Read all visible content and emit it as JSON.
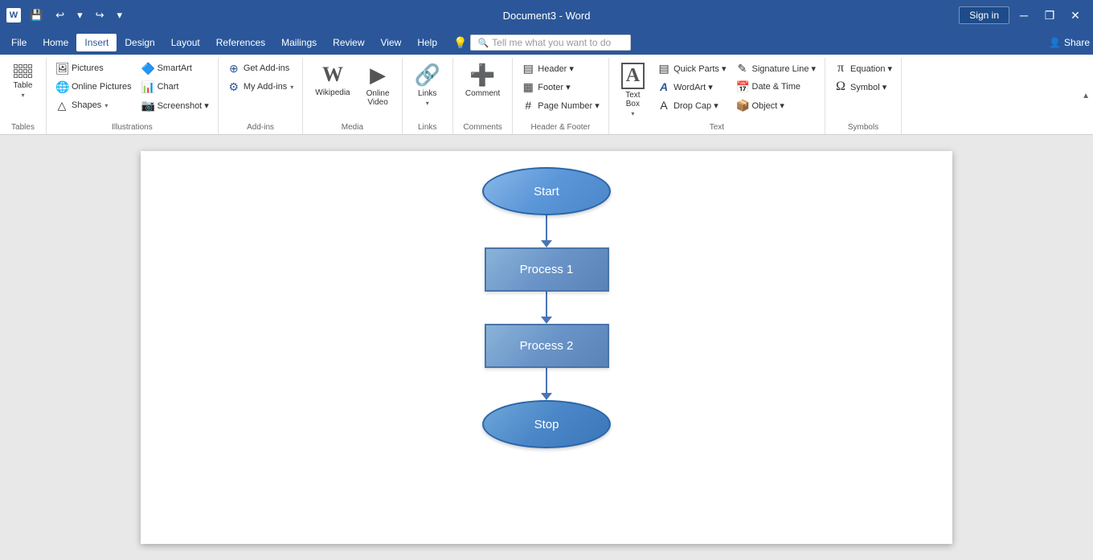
{
  "titlebar": {
    "app_icon": "W",
    "document_title": "Document3 - Word",
    "qat": {
      "save": "💾",
      "undo": "↩",
      "undo_dropdown": "▾",
      "redo": "↪",
      "customize": "▾"
    },
    "sign_in_label": "Sign in",
    "win_minimize": "─",
    "win_restore": "❐",
    "win_close": "✕"
  },
  "menubar": {
    "items": [
      "File",
      "Home",
      "Insert",
      "Design",
      "Layout",
      "References",
      "Mailings",
      "Review",
      "View",
      "Help"
    ]
  },
  "ribbon": {
    "active_tab": "Insert",
    "groups": [
      {
        "name": "Tables",
        "label": "Tables",
        "buttons": [
          {
            "id": "table",
            "label": "Table",
            "icon": "table"
          }
        ]
      },
      {
        "name": "Illustrations",
        "label": "Illustrations",
        "buttons": [
          {
            "id": "pictures",
            "label": "Pictures",
            "icon": "🖼"
          },
          {
            "id": "online-pictures",
            "label": "Online Pictures",
            "icon": "🌐"
          },
          {
            "id": "shapes",
            "label": "Shapes",
            "icon": "△"
          },
          {
            "id": "smartart",
            "label": "SmartArt",
            "icon": "📊"
          },
          {
            "id": "chart",
            "label": "Chart",
            "icon": "📈"
          },
          {
            "id": "screenshot",
            "label": "Screenshot",
            "icon": "📷"
          }
        ]
      },
      {
        "name": "Add-ins",
        "label": "Add-ins",
        "buttons": [
          {
            "id": "get-addins",
            "label": "Get Add-ins",
            "icon": "⊕"
          },
          {
            "id": "my-addins",
            "label": "My Add-ins",
            "icon": "⚙"
          }
        ]
      },
      {
        "name": "Media",
        "label": "Media",
        "buttons": [
          {
            "id": "wikipedia",
            "label": "Wikipedia",
            "icon": "W"
          },
          {
            "id": "online-video",
            "label": "Online\nVideo",
            "icon": "▶"
          }
        ]
      },
      {
        "name": "Links",
        "label": "Links",
        "buttons": [
          {
            "id": "links",
            "label": "Links",
            "icon": "🔗"
          }
        ]
      },
      {
        "name": "Comments",
        "label": "Comments",
        "buttons": [
          {
            "id": "comment",
            "label": "Comment",
            "icon": "💬"
          }
        ]
      },
      {
        "name": "Header & Footer",
        "label": "Header & Footer",
        "buttons": [
          {
            "id": "header",
            "label": "Header ▾",
            "icon": "▤"
          },
          {
            "id": "footer",
            "label": "Footer ▾",
            "icon": "▦"
          },
          {
            "id": "page-number",
            "label": "Page Number ▾",
            "icon": "#"
          }
        ]
      },
      {
        "name": "Text",
        "label": "Text",
        "buttons": [
          {
            "id": "text-box",
            "label": "Text\nBox",
            "icon": "A"
          },
          {
            "id": "quick-parts",
            "label": "",
            "icon": "▤"
          },
          {
            "id": "wordart",
            "label": "",
            "icon": "A"
          },
          {
            "id": "drop-cap",
            "label": "",
            "icon": "A"
          },
          {
            "id": "signature-line",
            "label": "",
            "icon": "✎"
          },
          {
            "id": "date-time",
            "label": "",
            "icon": "📅"
          },
          {
            "id": "object",
            "label": "",
            "icon": "📦"
          }
        ]
      },
      {
        "name": "Symbols",
        "label": "Symbols",
        "buttons": [
          {
            "id": "equation",
            "label": "Equation ▾",
            "icon": "π"
          },
          {
            "id": "symbol",
            "label": "Symbol ▾",
            "icon": "Ω"
          }
        ]
      }
    ],
    "tell_me_placeholder": "Tell me what you want to do"
  },
  "flowchart": {
    "start_label": "Start",
    "process1_label": "Process 1",
    "process2_label": "Process 2",
    "stop_label": "Stop"
  }
}
